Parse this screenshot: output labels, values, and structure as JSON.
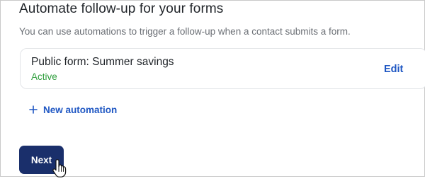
{
  "section": {
    "heading": "Automate follow-up for your forms",
    "description": "You can use automations to trigger a follow-up when a contact submits a form."
  },
  "automation_card": {
    "title": "Public form: Summer savings",
    "status": "Active",
    "edit_label": "Edit"
  },
  "new_automation": {
    "icon": "plus-icon",
    "label": "New automation"
  },
  "footer": {
    "next_label": "Next"
  },
  "cursor": {
    "icon": "hand-pointer-icon"
  },
  "colors": {
    "accent": "#1f57c3",
    "primary_button": "#1a2f6b",
    "status_active": "#2e9e3c",
    "muted_text": "#6b6f75"
  }
}
